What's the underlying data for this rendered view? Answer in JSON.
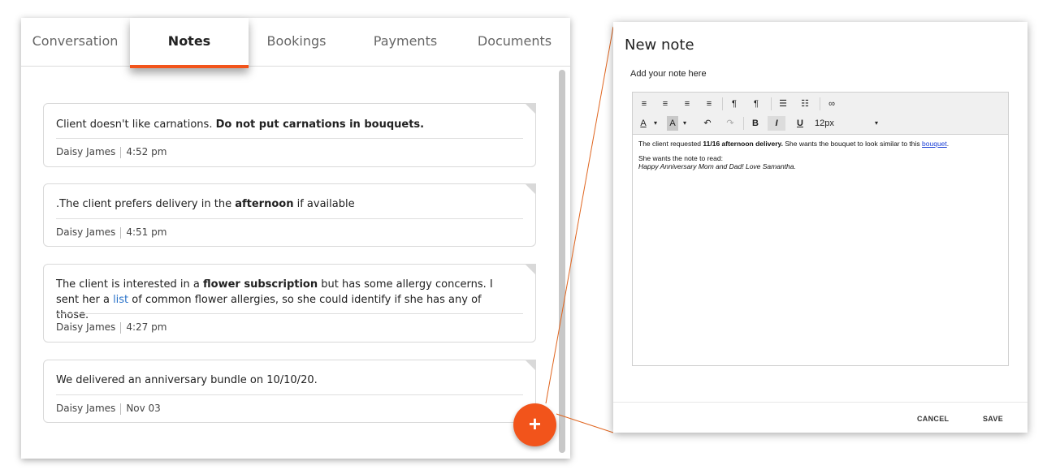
{
  "tabs": [
    {
      "label": "Conversation",
      "active": false
    },
    {
      "label": "Notes",
      "active": true
    },
    {
      "label": "Bookings",
      "active": false
    },
    {
      "label": "Payments",
      "active": false
    },
    {
      "label": "Documents",
      "active": false
    }
  ],
  "notes": [
    {
      "text_plain": "Client doesn't like carnations. ",
      "text_bold": "Do not put carnations in bouquets.",
      "author": "Daisy James",
      "time": "4:52 pm"
    },
    {
      "text_pre": ".The client prefers delivery in the ",
      "text_bold": "afternoon",
      "text_post": " if available",
      "author": "Daisy James",
      "time": "4:51 pm"
    },
    {
      "text_pre": "The client is interested in a ",
      "text_bold": "flower subscription",
      "text_mid": " but has some allergy concerns. I sent her a ",
      "text_link": "list",
      "text_post": " of common flower allergies, so she could identify if she has any of those.",
      "author": "Daisy James",
      "time": "4:27 pm"
    },
    {
      "text_plain": "We delivered an anniversary bundle on 10/10/20.",
      "author": "Daisy James",
      "time": "Nov 03"
    }
  ],
  "fab": {
    "label": "+",
    "icon": "plus-icon",
    "color": "#f2541b"
  },
  "dialog": {
    "title": "New note",
    "subtitle": "Add your note here",
    "font_size": "12px",
    "body": {
      "line1_pre": "The client requested ",
      "line1_bold": "11/16 afternoon delivery.",
      "line1_mid": " She wants the bouquet to look similar to this ",
      "line1_link": "bouquet",
      "line1_post": ".",
      "line2": "She wants the note to read:",
      "line3": "Happy Anniversary Mom and Dad! Love Samantha."
    },
    "cancel_label": "CANCEL",
    "save_label": "SAVE"
  },
  "colors": {
    "accent": "#f2541b",
    "link": "#2a73c9"
  }
}
